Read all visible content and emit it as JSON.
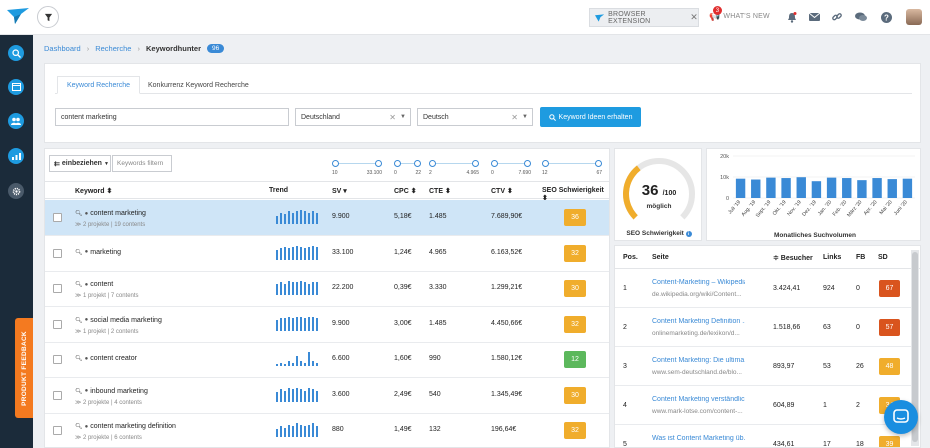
{
  "topbar": {
    "browser_extension": "BROWSER EXTENSION",
    "whats_new": "WHAT'S NEW",
    "whats_new_badge": "3",
    "icons": [
      "bell-icon",
      "mail-icon",
      "link-icon",
      "chat-icon",
      "help-icon"
    ]
  },
  "sidebar": {
    "feedback": "PRODUKT FEEDBACK",
    "icons": [
      "search-icon",
      "window-icon",
      "users-icon",
      "chart-icon",
      "gear-icon"
    ]
  },
  "breadcrumb": {
    "dashboard": "Dashboard",
    "recherche": "Recherche",
    "current": "Keywordhunter",
    "count": "96"
  },
  "search": {
    "tab_active": "Keyword Recherche",
    "tab_other": "Konkurrenz Keyword Recherche",
    "query": "content marketing",
    "country": "Deutschland",
    "language": "Deutsch",
    "button": "Keyword Ideen erhalten"
  },
  "table": {
    "include_label": "einbeziehen",
    "filter_placeholder": "Keywords filtern",
    "sliders": [
      {
        "lo": "10",
        "hi": "33.100"
      },
      {
        "lo": "0",
        "hi": "22"
      },
      {
        "lo": "2",
        "hi": "4.965"
      },
      {
        "lo": "0",
        "hi": "7.690"
      },
      {
        "lo": "12",
        "hi": "67"
      }
    ],
    "headers": {
      "keyword": "Keyword ⬍",
      "trend": "Trend",
      "sv": "SV ▾",
      "cpc": "CPC ⬍",
      "cte": "CTE ⬍",
      "ctv": "CTV ⬍",
      "sd": "SEO Schwierigkeit ⬍"
    },
    "rows": [
      {
        "keyword": "content marketing",
        "sub": "≫ 2 projekte | 19 contents",
        "sv": "9.900",
        "cpc": "5,18€",
        "cte": "1.485",
        "ctv": "7.689,90€",
        "sd": "36",
        "sd_color": "#f0ad2c",
        "trend": [
          6,
          8,
          7,
          9,
          8,
          9,
          10,
          9,
          8,
          9,
          8
        ]
      },
      {
        "keyword": "marketing",
        "sub": "",
        "sv": "33.100",
        "cpc": "1,24€",
        "cte": "4.965",
        "ctv": "6.163,52€",
        "sd": "32",
        "sd_color": "#f0ad2c",
        "trend": [
          7,
          8,
          9,
          8,
          9,
          10,
          9,
          8,
          9,
          10,
          9
        ]
      },
      {
        "keyword": "content",
        "sub": "≫ 1 projekt | 7 contents",
        "sv": "22.200",
        "cpc": "0,39€",
        "cte": "3.330",
        "ctv": "1.299,21€",
        "sd": "30",
        "sd_color": "#f0ad2c",
        "trend": [
          8,
          9,
          8,
          10,
          9,
          9,
          10,
          9,
          8,
          9,
          9
        ]
      },
      {
        "keyword": "social media marketing",
        "sub": "≫ 1 projekt | 2 contents",
        "sv": "9.900",
        "cpc": "3,00€",
        "cte": "1.485",
        "ctv": "4.450,66€",
        "sd": "32",
        "sd_color": "#f0ad2c",
        "trend": [
          7,
          8,
          8,
          9,
          8,
          9,
          9,
          8,
          9,
          9,
          8
        ]
      },
      {
        "keyword": "content creator",
        "sub": "",
        "sv": "6.600",
        "cpc": "1,60€",
        "cte": "990",
        "ctv": "1.580,12€",
        "sd": "12",
        "sd_color": "#5cb85c",
        "trend": [
          2,
          3,
          2,
          4,
          3,
          9,
          4,
          3,
          12,
          4,
          3
        ]
      },
      {
        "keyword": "inbound marketing",
        "sub": "≫ 2 projekte | 4 contents",
        "sv": "3.600",
        "cpc": "2,49€",
        "cte": "540",
        "ctv": "1.345,49€",
        "sd": "30",
        "sd_color": "#f0ad2c",
        "trend": [
          6,
          8,
          7,
          9,
          8,
          9,
          8,
          7,
          9,
          8,
          7
        ]
      },
      {
        "keyword": "content marketing definition",
        "sub": "≫ 2 projekte | 6 contents",
        "sv": "880",
        "cpc": "1,49€",
        "cte": "132",
        "ctv": "196,64€",
        "sd": "32",
        "sd_color": "#f0ad2c",
        "trend": [
          5,
          7,
          6,
          8,
          7,
          9,
          8,
          7,
          8,
          9,
          7
        ]
      }
    ]
  },
  "gauge": {
    "value": "36",
    "max": "/100",
    "sub": "möglich",
    "label": "SEO Schwierigkeit",
    "fraction": 0.36
  },
  "chart_data": {
    "type": "bar",
    "xlabel": "Monatliches Suchvolumen",
    "ylabel": "",
    "ylim": [
      0,
      20000
    ],
    "yticks": [
      "20k",
      "10k",
      "0"
    ],
    "categories": [
      "Juli '19",
      "Aug. '19",
      "Sept. '19",
      "Okt. '19",
      "Nov. '19",
      "Dez. '19",
      "Jan. '20",
      "Feb. '20",
      "März '20",
      "Apr. '20",
      "Mai '20",
      "Juni '20"
    ],
    "values": [
      9200,
      8800,
      9700,
      9500,
      9900,
      8000,
      9700,
      9500,
      8500,
      9500,
      9000,
      9200
    ],
    "color": "#3a8ad6"
  },
  "serp": {
    "headers": {
      "pos": "Pos.",
      "seite": "Seite",
      "besucher": "≑ Besucher",
      "links": "Links",
      "fb": "FB",
      "sd": "SD"
    },
    "rows": [
      {
        "pos": "1",
        "title": "Content-Marketing – Wikipedia",
        "url": "de.wikipedia.org/wiki/Content...",
        "besucher": "3.424,41",
        "links": "924",
        "fb": "0",
        "sd": "67",
        "sd_color": "#d9541e"
      },
      {
        "pos": "2",
        "title": "Content Marketing Definition ...",
        "url": "onlinemarketing.de/lexikon/d...",
        "besucher": "1.518,66",
        "links": "63",
        "fb": "0",
        "sd": "57",
        "sd_color": "#d9541e"
      },
      {
        "pos": "3",
        "title": "Content Marketing: Die ultima...",
        "url": "www.sem-deutschland.de/blo...",
        "besucher": "893,97",
        "links": "53",
        "fb": "26",
        "sd": "48",
        "sd_color": "#f0ad2c"
      },
      {
        "pos": "4",
        "title": "Content Marketing verständlic...",
        "url": "www.mark-lotse.com/content-...",
        "besucher": "604,89",
        "links": "1",
        "fb": "2",
        "sd": "34",
        "sd_color": "#f0ad2c"
      },
      {
        "pos": "5",
        "title": "Was ist Content Marketing üb...",
        "url": "www.t3n.de/...",
        "besucher": "434,61",
        "links": "17",
        "fb": "18",
        "sd": "39",
        "sd_color": "#f0ad2c"
      }
    ]
  }
}
